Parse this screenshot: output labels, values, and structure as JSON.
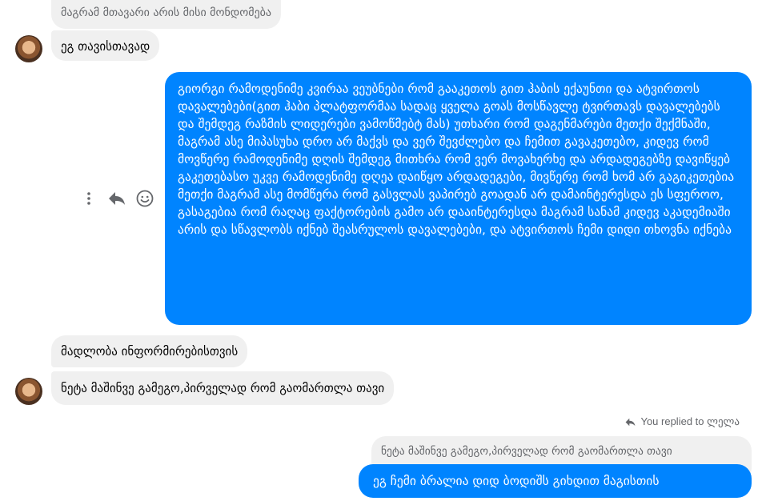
{
  "messages": {
    "incoming_top_preview": "მაგრამ მთავარი არის მისი მონდომება",
    "incoming_1": "ეგ თავისთავად",
    "outgoing_long": "გიორგი რამოდენიმე კვირაა ვეუბნები რომ გააკეთოს გით ჰაბის ექაუნთი და ატვირთოს დავალებები(გით ჰაბი პლატფორმაა სადაც ყველა გოას მოსწავლე ტვირთავს დავალებებს და შემდეგ რაზმის ლიდერები ვამოწმებტ მას) უთხარი რომ დაგენმარები მეთქი შექმნაში, მაგრამ ასე მიპასუხა დრო არ მაქვს და ვერ შევძლებო და ჩემით გავაკეთებო, კიდევ რომ მოვწერე რამოდენიმე დღის შემდეგ მითხრა რომ ვერ მოვახერხე და არდადეგებზე დავიწყებ გაკეთებასო უკვე რამოდენიმე დღეა დაიწყო არდადეგები, მივწერე რომ ხომ არ გაგიკეთებია მეთქი მაგრამ ასე მომწერა რომ გასვლას ვაპირებ გოადან არ დამაინტერესდა ეს სფეროო, გასაგებია რომ რაღაც ფაქტორების გამო არ დააინტერესდა მაგრამ სანამ კიდევ აკადემიაში არის და სწავლობს იქნებ შეასრულოს დავალებები, და ატვირთოს ჩემი დიდი თხოვნა იქნება",
    "incoming_2": "მადლობა ინფორმირებისთვის",
    "incoming_3": "ნეტა მაშინვე გამეგო,პირველად რომ გაომართლა თავი",
    "replied_to_label": "You replied to ლელა",
    "reply_preview": "ნეტა მაშინვე გამეგო,პირველად რომ გაომართლა თავი",
    "outgoing_reply": "ეგ ჩემი ბრალია დიდ ბოდიშს გიხდით მაგისთის"
  },
  "icons": {
    "more": "more-vertical-icon",
    "reply": "reply-icon",
    "react": "smiley-icon",
    "replied": "reply-arrow-icon"
  },
  "colors": {
    "outgoing_bubble": "#0084ff",
    "incoming_bubble": "#f0f0f0"
  }
}
